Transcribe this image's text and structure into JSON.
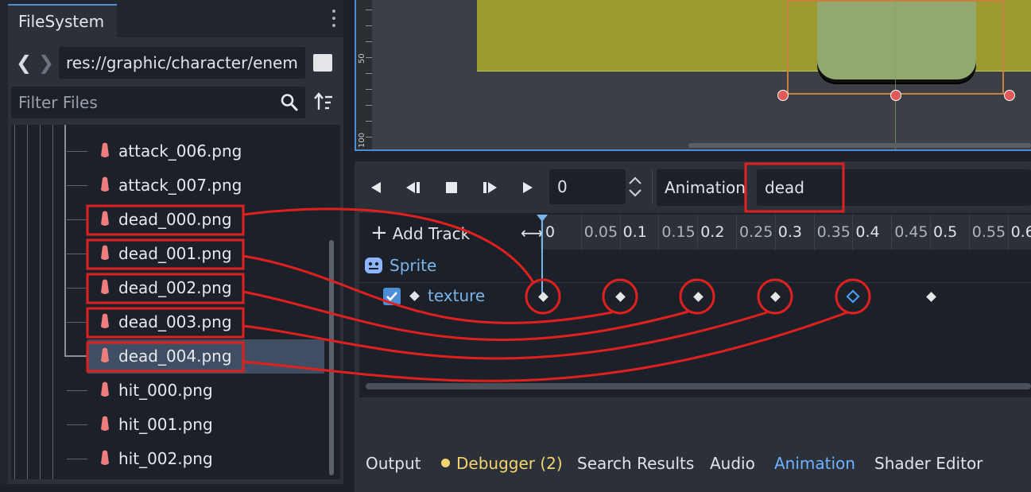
{
  "filesystem": {
    "tab_title": "FileSystem",
    "path": "res://graphic/character/enem",
    "filter_placeholder": "Filter Files",
    "files": [
      {
        "name": "attack_006.png",
        "icon": "image-file-icon"
      },
      {
        "name": "attack_007.png",
        "icon": "image-file-icon"
      },
      {
        "name": "dead_000.png",
        "icon": "image-file-icon"
      },
      {
        "name": "dead_001.png",
        "icon": "image-file-icon"
      },
      {
        "name": "dead_002.png",
        "icon": "image-file-icon"
      },
      {
        "name": "dead_003.png",
        "icon": "image-file-icon"
      },
      {
        "name": "dead_004.png",
        "icon": "image-file-icon",
        "selected": true
      },
      {
        "name": "hit_000.png",
        "icon": "image-file-icon"
      },
      {
        "name": "hit_001.png",
        "icon": "image-file-icon"
      },
      {
        "name": "hit_002.png",
        "icon": "image-file-icon"
      }
    ]
  },
  "viewport": {
    "ruler_labels": [
      "50",
      "100"
    ]
  },
  "animation_editor": {
    "time_value": "0",
    "animation_label": "Animation",
    "animation_name": "dead",
    "add_track_label": "Add Track",
    "timeline_ticks": [
      "0",
      "0.05",
      "0.1",
      "0.15",
      "0.2",
      "0.25",
      "0.3",
      "0.35",
      "0.4",
      "0.45",
      "0.5",
      "0.55",
      "0.6"
    ],
    "node_name": "Sprite",
    "track_property": "texture",
    "keyframes": [
      0,
      0.1,
      0.2,
      0.3,
      0.4,
      0.5
    ],
    "selected_keyframe": 0.4
  },
  "bottom_panel": {
    "tabs": [
      {
        "label": "Output",
        "state": "normal"
      },
      {
        "label": "Debugger (2)",
        "state": "warn"
      },
      {
        "label": "Search Results",
        "state": "normal"
      },
      {
        "label": "Audio",
        "state": "normal"
      },
      {
        "label": "Animation",
        "state": "active"
      },
      {
        "label": "Shader Editor",
        "state": "normal"
      }
    ]
  },
  "colors": {
    "accent": "#4d8fd6",
    "annotation_red": "#e0201f",
    "warning": "#f4d470"
  }
}
